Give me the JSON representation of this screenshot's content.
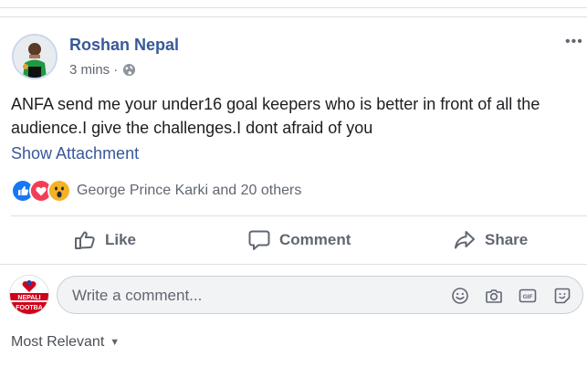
{
  "post": {
    "author": "Roshan Nepal",
    "time": "3 mins",
    "separator": "·",
    "text": "ANFA send me your under16 goal keepers who is better in front of all the audience.I give the challenges.I dont afraid of you",
    "attachment_link": "Show Attachment",
    "more_icon": "•••"
  },
  "reactions": {
    "icons": [
      "like-icon",
      "love-icon",
      "wow-icon"
    ],
    "summary": "George Prince Karki and 20 others"
  },
  "actions": {
    "like": "Like",
    "comment": "Comment",
    "share": "Share"
  },
  "comment_composer": {
    "placeholder": "Write a comment...",
    "avatar_text_top": "NEPALI",
    "avatar_text_bottom": "FOOTBA",
    "icons": [
      "emoji-icon",
      "camera-icon",
      "gif-icon",
      "sticker-icon"
    ],
    "gif_label": "GIF"
  },
  "sort": {
    "label": "Most Relevant",
    "caret": "▼"
  },
  "colors": {
    "link": "#385898",
    "muted": "#606770",
    "like_blue": "#1877f2",
    "love_red": "#f33e58",
    "wow_yellow": "#f7b125"
  }
}
